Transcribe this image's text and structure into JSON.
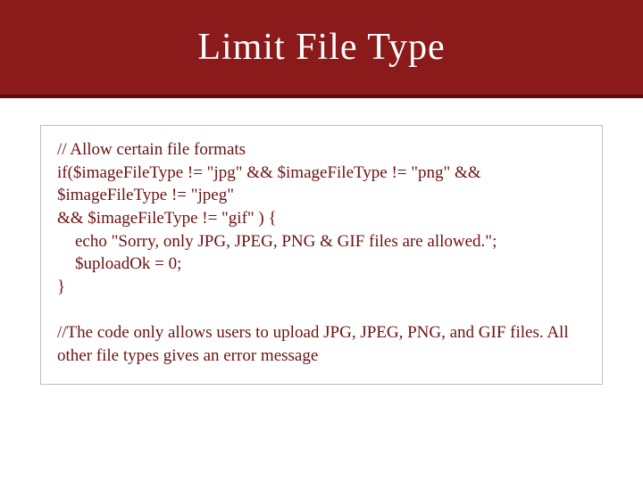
{
  "header": {
    "title": "Limit File Type"
  },
  "code": {
    "l1": "// Allow certain file formats",
    "l2": "if($imageFileType != \"jpg\" && $imageFileType != \"png\" && $imageFileType != \"jpeg\"",
    "l3": "&& $imageFileType != \"gif\" ) {",
    "l4": "echo \"Sorry, only JPG, JPEG, PNG & GIF files are allowed.\";",
    "l5": "$uploadOk = 0;",
    "l6": "}",
    "l7": "//The code only allows users to upload JPG, JPEG, PNG, and GIF files. All other file types gives an error message"
  }
}
